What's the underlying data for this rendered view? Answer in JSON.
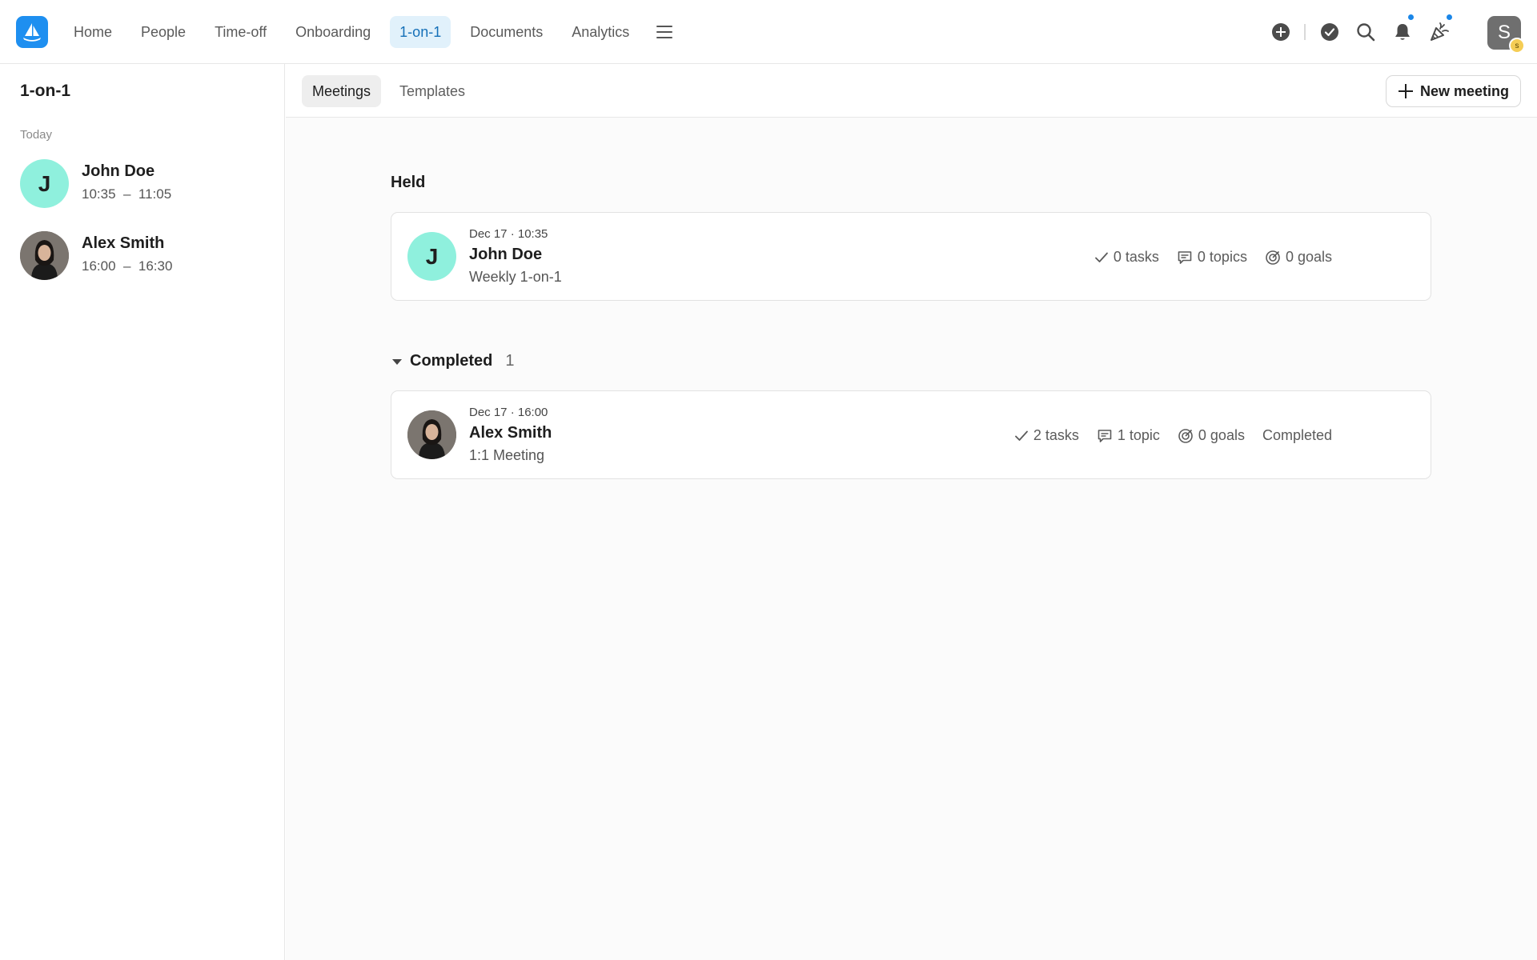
{
  "nav": {
    "items": [
      {
        "label": "Home",
        "active": false
      },
      {
        "label": "People",
        "active": false
      },
      {
        "label": "Time-off",
        "active": false
      },
      {
        "label": "Onboarding",
        "active": false
      },
      {
        "label": "1-on-1",
        "active": true
      },
      {
        "label": "Documents",
        "active": false
      },
      {
        "label": "Analytics",
        "active": false
      }
    ],
    "user_initial": "S",
    "user_badge": "s",
    "icons": [
      "add-circle-icon",
      "check-circle-icon",
      "search-icon",
      "bell-icon",
      "party-popper-icon"
    ]
  },
  "sidebar": {
    "title": "1-on-1",
    "section_label": "Today",
    "entries": [
      {
        "name": "John Doe",
        "time": "10:35  –  11:05",
        "initial": "J",
        "avatar": "letter"
      },
      {
        "name": "Alex Smith",
        "time": "16:00  –  16:30",
        "initial": "",
        "avatar": "photo"
      }
    ]
  },
  "main": {
    "tabs": [
      {
        "label": "Meetings",
        "active": true
      },
      {
        "label": "Templates",
        "active": false
      }
    ],
    "new_meeting_label": "New meeting",
    "held": {
      "heading": "Held",
      "meeting": {
        "meta": "Dec 17 · 10:35",
        "name": "John Doe",
        "type": "Weekly 1-on-1",
        "initial": "J",
        "tasks": "0 tasks",
        "topics": "0 topics",
        "goals": "0 goals"
      }
    },
    "completed": {
      "heading": "Completed",
      "count": "1",
      "meeting": {
        "meta": "Dec 17 · 16:00",
        "name": "Alex Smith",
        "type": "1:1 Meeting",
        "tasks": "2 tasks",
        "topics": "1 topic",
        "goals": "0 goals",
        "status": "Completed"
      }
    }
  },
  "colors": {
    "accent": "#1e8ff0",
    "active_tab_bg": "#e1f1fb",
    "avatar_teal": "#8ff0dd",
    "notification_dot": "#1a86e8"
  }
}
